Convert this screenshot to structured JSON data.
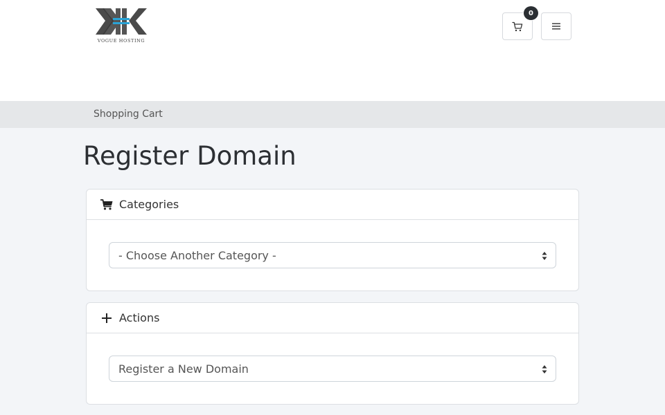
{
  "header": {
    "logo_text": "VOGUE HOSTING",
    "cart_count": "0",
    "icons": {
      "cart": "cart-icon",
      "menu": "hamburger-menu-icon"
    }
  },
  "breadcrumb": {
    "current": "Shopping Cart"
  },
  "page": {
    "title": "Register Domain"
  },
  "categories_panel": {
    "title": "Categories",
    "icon": "shopping-cart-icon",
    "select_value": "- Choose Another Category -"
  },
  "actions_panel": {
    "title": "Actions",
    "icon": "plus-icon",
    "select_value": "Register a New Domain"
  },
  "colors": {
    "page_bg": "#f3f5f8",
    "breadcrumb_bg": "#e5e7e9",
    "badge_bg": "#2b2f33",
    "logo_accent": "#29a3d6"
  }
}
